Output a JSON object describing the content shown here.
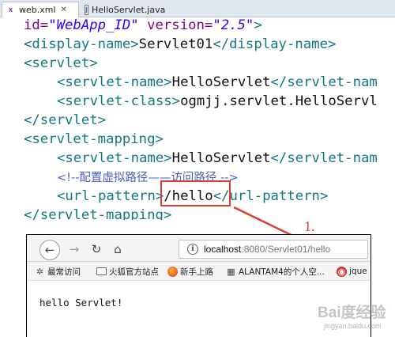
{
  "editor": {
    "tabs": [
      {
        "label": "web.xml",
        "icon": "xml-file-icon",
        "close": "✕",
        "active": true
      },
      {
        "label": "HelloServlet.java",
        "icon": "java-file-icon",
        "active": false
      }
    ],
    "lines": {
      "l0_pre": "id=",
      "l0_val": "\"WebApp_ID\"",
      "l0_attr": " version=",
      "l0_val2": "\"2.5\"",
      "l0_tag": ">",
      "l1_open": "<display-name>",
      "l1_text": "Servlet01",
      "l1_close": "</display-name>",
      "l2": "<servlet>",
      "l3_open": "<servlet-name>",
      "l3_text": "HelloServlet",
      "l3_close": "</servlet-nam",
      "l4_open": "<servlet-class>",
      "l4_text": "ogmjj.servlet.HelloServl",
      "l5": "</servlet>",
      "l6": "<servlet-mapping>",
      "l7_open": "<servlet-name>",
      "l7_text": "HelloServlet",
      "l7_close": "</servlet-nam",
      "l8_comment": "<!--配置虚拟路径——访问路径 -->",
      "l9_open": "<url-pattern",
      "l9_gt": ">",
      "l9_text": "/hello",
      "l9_lt": "<",
      "l9_close": "/url-pattern>",
      "l10": "</servlet-mapping>"
    }
  },
  "annotation": {
    "number_label": "1.",
    "color": "#e33a2c"
  },
  "browser": {
    "nav": {
      "back": "←",
      "forward": "→",
      "reload": "↻",
      "home": "⌂"
    },
    "url": {
      "info": "i",
      "host": "localhost",
      "rest": ":8080/Servlet01/hello"
    },
    "bookmarks": [
      {
        "label": "最常访问",
        "icon": "gear-icon"
      },
      {
        "label": "火狐官方站点",
        "icon": "folder-icon"
      },
      {
        "label": "新手上路",
        "icon": "firefox-icon"
      },
      {
        "label": "ALANTAM4的个人空...",
        "icon": "grid-icon"
      },
      {
        "label": "jque",
        "icon": "jquery-icon"
      }
    ],
    "content": "hello Servlet!"
  },
  "watermark": {
    "text": "Bai度经验",
    "url": "jingyan.baidu.com"
  }
}
